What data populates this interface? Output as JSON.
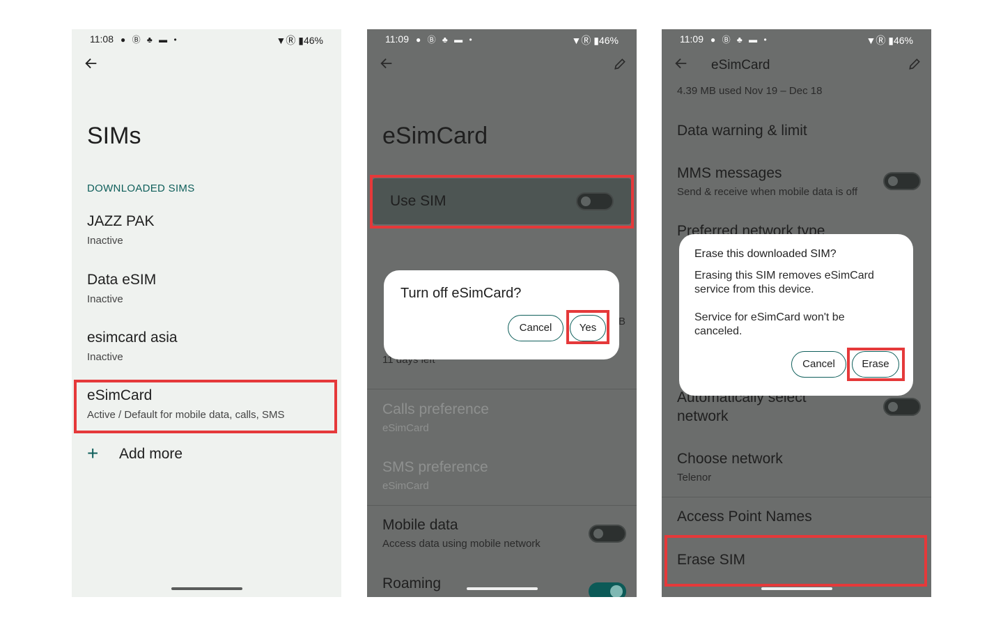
{
  "screen1": {
    "status": {
      "time": "11:08",
      "icons": "● Ⓑ ♣ ▬ •",
      "right": "▼Ⓡ ▮46%"
    },
    "title": "SIMs",
    "section": "DOWNLOADED SIMS",
    "sims": [
      {
        "name": "JAZZ PAK",
        "status": "Inactive"
      },
      {
        "name": "Data eSIM",
        "status": "Inactive"
      },
      {
        "name": "esimcard asia",
        "status": "Inactive"
      },
      {
        "name": "eSimCard",
        "status": "Active / Default for mobile data, calls, SMS"
      }
    ],
    "add_more": "Add more",
    "add_icon": "+"
  },
  "screen2": {
    "status": {
      "time": "11:09",
      "icons": "● Ⓑ ♣ ▬ •",
      "right": "▼Ⓡ ▮46%"
    },
    "title": "eSimCard",
    "use_sim": "Use SIM",
    "behind_text": "11 days left",
    "behind_b": "B",
    "calls_pref": "Calls preference",
    "calls_pref_sub": "eSimCard",
    "sms_pref": "SMS preference",
    "sms_pref_sub": "eSimCard",
    "mobile_data": "Mobile data",
    "mobile_data_sub": "Access data using mobile network",
    "roaming": "Roaming",
    "dialog": {
      "title": "Turn off eSimCard?",
      "cancel": "Cancel",
      "yes": "Yes"
    }
  },
  "screen3": {
    "status": {
      "time": "11:09",
      "icons": "● Ⓑ ♣ ▬ •",
      "right": "▼Ⓡ ▮46%"
    },
    "header_title": "eSimCard",
    "usage": "4.39 MB used Nov 19 – Dec 18",
    "data_warning": "Data warning & limit",
    "mms": "MMS messages",
    "mms_sub": "Send & receive when mobile data is off",
    "preferred": "Preferred network type",
    "auto_select_1": "Automatically select",
    "auto_select_2": "network",
    "choose_network": "Choose network",
    "choose_network_sub": "Telenor",
    "apn": "Access Point Names",
    "erase_sim": "Erase SIM",
    "dialog": {
      "title": "Erase this downloaded SIM?",
      "body1_a": "Erasing this SIM removes eSimCard",
      "body1_b": "service from this device.",
      "body2_a": "Service for eSimCard won't be",
      "body2_b": "canceled.",
      "cancel": "Cancel",
      "erase": "Erase"
    }
  },
  "colors": {
    "accent": "#0f5f5b",
    "highlight": "#e5393a",
    "light_bg": "#eff2ef",
    "dim_bg": "#6b6d6c"
  }
}
